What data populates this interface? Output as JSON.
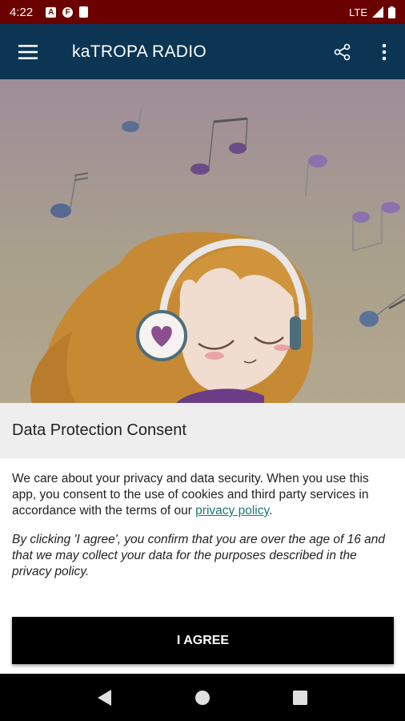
{
  "status_bar": {
    "time": "4:22",
    "network": "LTE",
    "icons": [
      "a-icon",
      "f-icon",
      "sd-card-icon"
    ]
  },
  "app_bar": {
    "title": "kaTROPA RADIO",
    "icons": [
      "menu-icon",
      "share-icon",
      "more-vert-icon"
    ]
  },
  "dialog": {
    "title": "Data Protection Consent",
    "body_text": "We care about your privacy and data security. When you use this app, you consent to the use of cookies and third party services in accordance with the terms of our ",
    "privacy_link": "privacy policy",
    "body_suffix": ".",
    "notice": "By clicking 'I agree', you confirm that you are over the age of 16 and that we may collect your data for the purposes described in the privacy policy.",
    "agree_button": "I AGREE"
  },
  "nav_bar": {
    "icons": [
      "back-icon",
      "home-icon",
      "recents-icon"
    ]
  },
  "colors": {
    "status_bar": "#6a0000",
    "app_bar": "#0c3554",
    "link": "#1a7a70",
    "button": "#000000"
  }
}
